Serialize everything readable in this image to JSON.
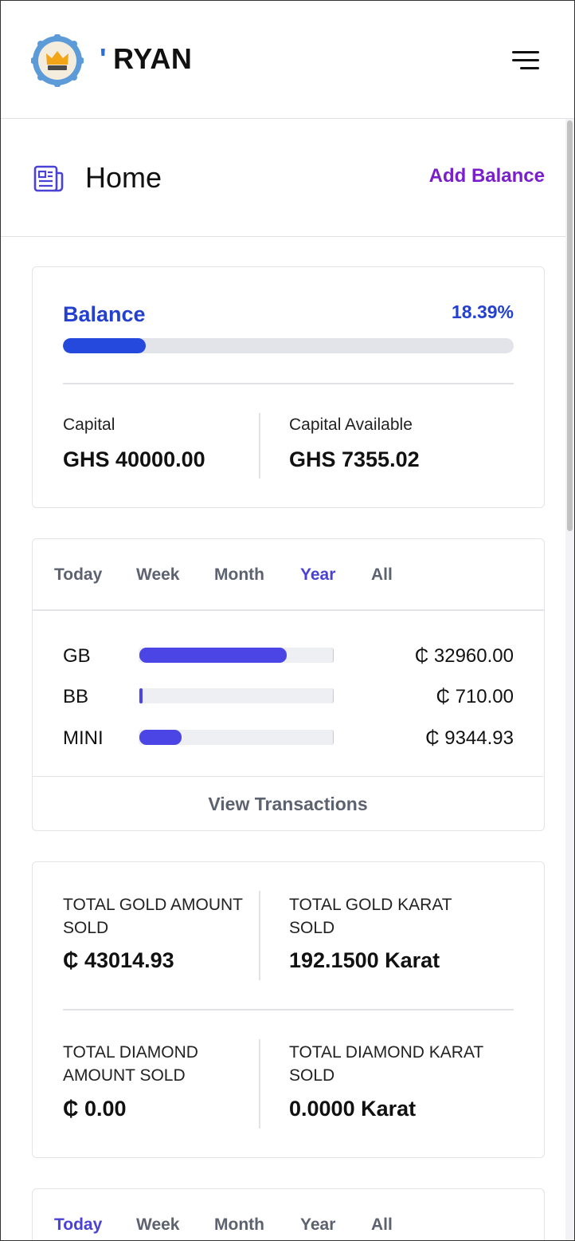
{
  "header": {
    "brand_mark": "'",
    "brand_name": "RYAN",
    "logo_icon": "crown-badge-icon",
    "menu_icon": "hamburger-menu-icon"
  },
  "page": {
    "title": "Home",
    "title_icon": "news-icon",
    "add_balance_label": "Add Balance"
  },
  "balance": {
    "title": "Balance",
    "percent_label": "18.39%",
    "progress_fraction": 0.1839,
    "capital_label": "Capital",
    "capital_value": "GHS 40000.00",
    "capital_available_label": "Capital Available",
    "capital_available_value": "GHS 7355.02"
  },
  "period_tabs": {
    "items": [
      "Today",
      "Week",
      "Month",
      "Year",
      "All"
    ],
    "active": "Year"
  },
  "breakdown": {
    "rows": [
      {
        "label": "GB",
        "value": "₵ 32960.00",
        "fraction": 0.762
      },
      {
        "label": "BB",
        "value": "₵ 710.00",
        "fraction": 0.018
      },
      {
        "label": "MINI",
        "value": "₵ 9344.93",
        "fraction": 0.217
      }
    ],
    "view_transactions_label": "View Transactions"
  },
  "totals": {
    "gold_amount_label": "TOTAL GOLD AMOUNT SOLD",
    "gold_amount_value": "₵ 43014.93",
    "gold_karat_label": "TOTAL GOLD KARAT SOLD",
    "gold_karat_value": "192.1500 Karat",
    "diamond_amount_label": "TOTAL DIAMOND AMOUNT SOLD",
    "diamond_amount_value": "₵ 0.00",
    "diamond_karat_label": "TOTAL DIAMOND KARAT SOLD",
    "diamond_karat_value": "0.0000 Karat"
  },
  "period_tabs_2": {
    "items": [
      "Today",
      "Week",
      "Month",
      "Year",
      "All"
    ],
    "active": "Today"
  },
  "colors": {
    "accent_blue": "#2340cf",
    "bar_purple": "#4b45e6",
    "add_balance_purple": "#7a1fc9",
    "brand_tick": "#2b6fd6"
  }
}
